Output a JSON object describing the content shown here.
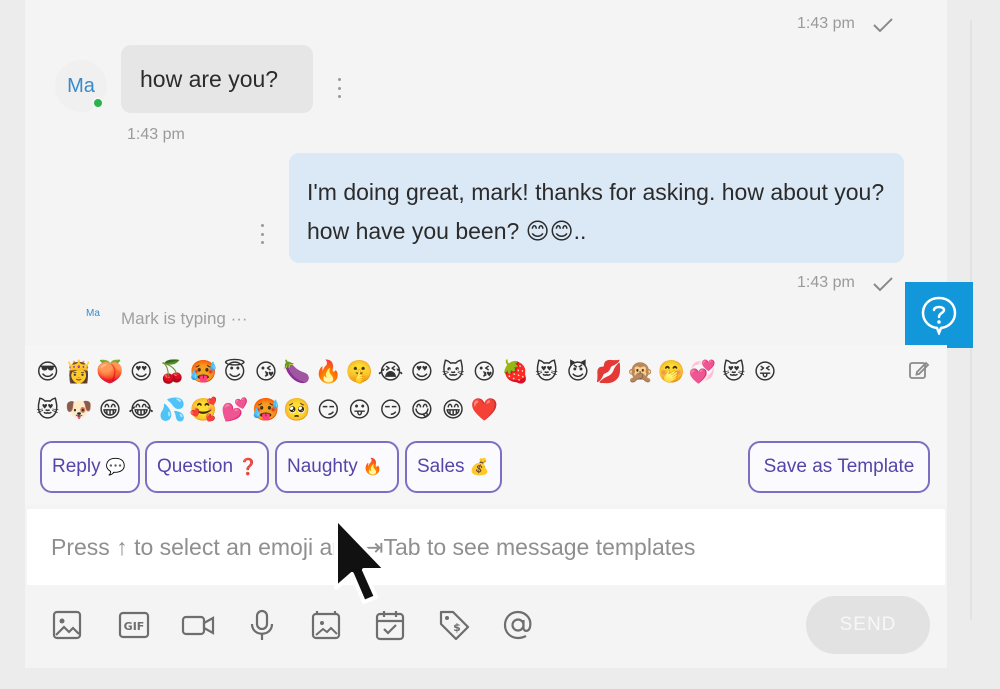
{
  "messages": [
    {
      "direction": "out-status",
      "time": "1:43 pm"
    },
    {
      "direction": "in",
      "avatar": "Ma",
      "text": "how are you?",
      "time": "1:43 pm"
    },
    {
      "direction": "out",
      "text": "I'm doing great, mark! thanks for asking. how about you? how have you been? 😊😊..",
      "time": "1:43 pm"
    }
  ],
  "typing": {
    "avatar": "Ma",
    "text": "Mark is typing ···"
  },
  "emojis_row1": [
    "😎",
    "👸",
    "🍑",
    "😍",
    "🍒",
    "🥵",
    "😇",
    "😘",
    "🍆",
    "🔥",
    "🤫",
    "😭",
    "😍",
    "🐱",
    "😘",
    "🍓",
    "😻",
    "😈",
    "💋",
    "🙊",
    "🤭",
    "💞",
    "😻",
    "😝"
  ],
  "emojis_row2": [
    "😻",
    "🐶",
    "😁",
    "😂",
    "💦",
    "🥰",
    "💕",
    "🥵",
    "🥺",
    "😏",
    "😛",
    "😏",
    "😋",
    "😁",
    "❤️"
  ],
  "templates": [
    {
      "label": "Reply",
      "icon": "💬"
    },
    {
      "label": "Question",
      "icon": "❓"
    },
    {
      "label": "Naughty",
      "icon": "🔥"
    },
    {
      "label": "Sales",
      "icon": "💰"
    }
  ],
  "save_template_label": "Save as Template",
  "input": {
    "placeholder": "Press ↑ to select an emoji and ⇥Tab to see message templates",
    "value": ""
  },
  "toolbar": {
    "icons": [
      "image-icon",
      "gif-icon",
      "video-icon",
      "microphone-icon",
      "vault-media-icon",
      "schedule-icon",
      "price-tag-icon",
      "mention-icon"
    ],
    "send_label": "SEND"
  },
  "colors": {
    "accent": "#7b6fc3",
    "help_blue": "#1297db",
    "outgoing_bubble": "#dbe9f6",
    "incoming_bubble": "#e6e6e6",
    "online": "#2bb24c"
  }
}
